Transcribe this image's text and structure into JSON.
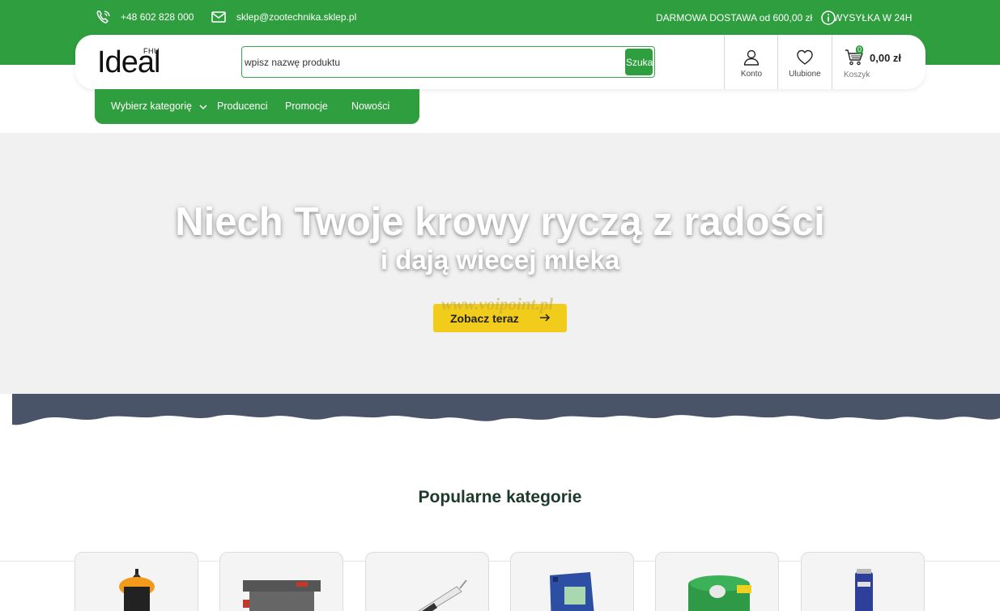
{
  "topbar": {
    "phone": "+48 602 828 000",
    "email": "sklep@zootechnika.sklep.pl",
    "free_delivery": "DARMOWA DOSTAWA od 600,00 zł",
    "shipping": "WYSYŁKA W 24H",
    "icons": [
      "phone-icon",
      "mail-icon",
      "info-icon"
    ]
  },
  "logo": {
    "main": "Ideal",
    "sub": "FHU"
  },
  "search": {
    "placeholder": "wpisz nazwę produktu",
    "button_label": "Szukaj"
  },
  "header": {
    "account_label": "Konto",
    "favorites_label": "Ulubione",
    "cart_label": "Koszyk",
    "cart_value": "0,00 zł",
    "cart_count": "0"
  },
  "nav": {
    "items": [
      {
        "label": "Wybierz kategorię"
      },
      {
        "label": "Producenci"
      },
      {
        "label": "Promocje"
      },
      {
        "label": "Nowości"
      }
    ]
  },
  "hero": {
    "title": "Niech Twoje krowy ryczą z radości",
    "subtitle": "i dają wiecej mleka",
    "button_label": "Zobacz teraz",
    "watermark": "www.voipoint.pl"
  },
  "categories": {
    "title": "Popularne kategorie",
    "items": [
      {
        "image": "black-orange-container"
      },
      {
        "image": "grey-feeding-trough"
      },
      {
        "image": "silicone-tube"
      },
      {
        "image": "blue-electric-fence-unit"
      },
      {
        "image": "green-water-trough"
      },
      {
        "image": "blue-spray-can"
      }
    ]
  },
  "colors": {
    "brand_green": "#2f9e3f",
    "hero_bg": "#f1f1f1",
    "button_yellow": "#f2cc1a",
    "dark_band": "#4a5468"
  }
}
